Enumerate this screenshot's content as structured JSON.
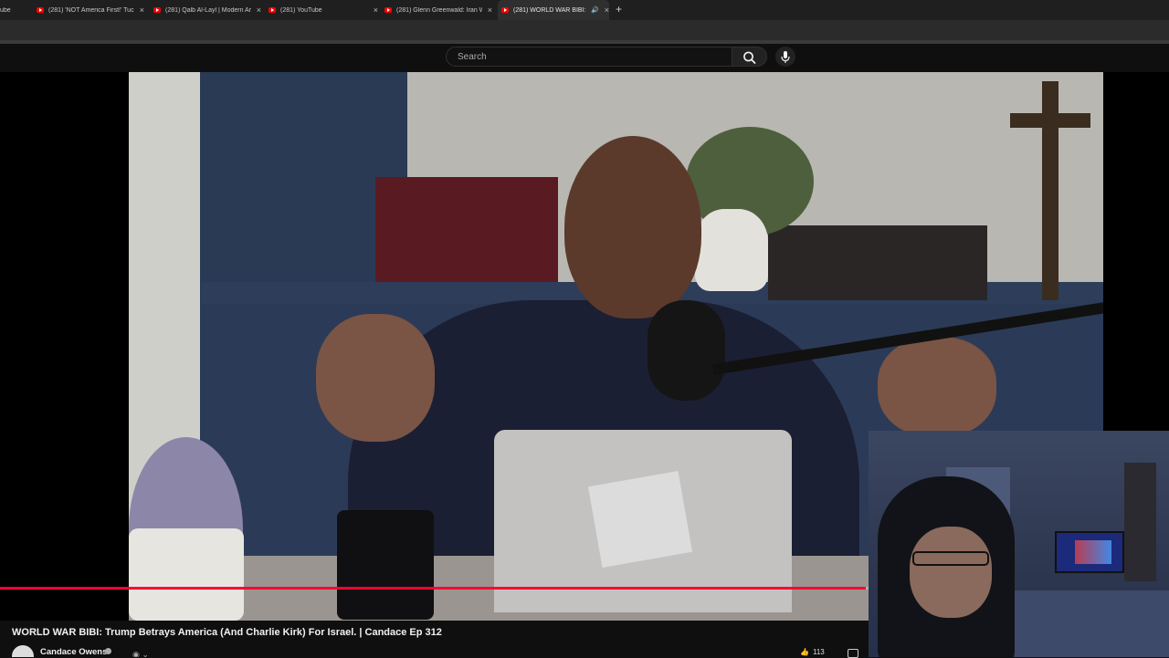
{
  "browser": {
    "tabs": [
      {
        "label": "ube",
        "active": false
      },
      {
        "label": "(281) 'NOT America First!' Tucke",
        "active": false
      },
      {
        "label": "(281) Qalb Al-Layl | Modern Ar",
        "active": false
      },
      {
        "label": "(281) YouTube",
        "active": false
      },
      {
        "label": "(281) Glenn Greenwald: Iran Wa",
        "active": false
      },
      {
        "label": "(281) WORLD WAR BIBI: Tr",
        "active": true
      }
    ],
    "close_glyph": "×",
    "new_tab_glyph": "+",
    "audio_glyph": "🔊"
  },
  "masthead": {
    "search_placeholder": "Search",
    "search_icon": "search-icon",
    "mic_icon": "mic-icon"
  },
  "player": {
    "progress_fraction": 0.741
  },
  "video": {
    "title": "WORLD WAR BIBI: Trump Betrays America (And Charlie Kirk) For Israel. | Candace Ep 312",
    "channel": "Candace Owens",
    "likes_label": "113"
  },
  "colors": {
    "progress": "#ff0033",
    "background": "#0f0f0f",
    "favicon": "#ff0000"
  }
}
